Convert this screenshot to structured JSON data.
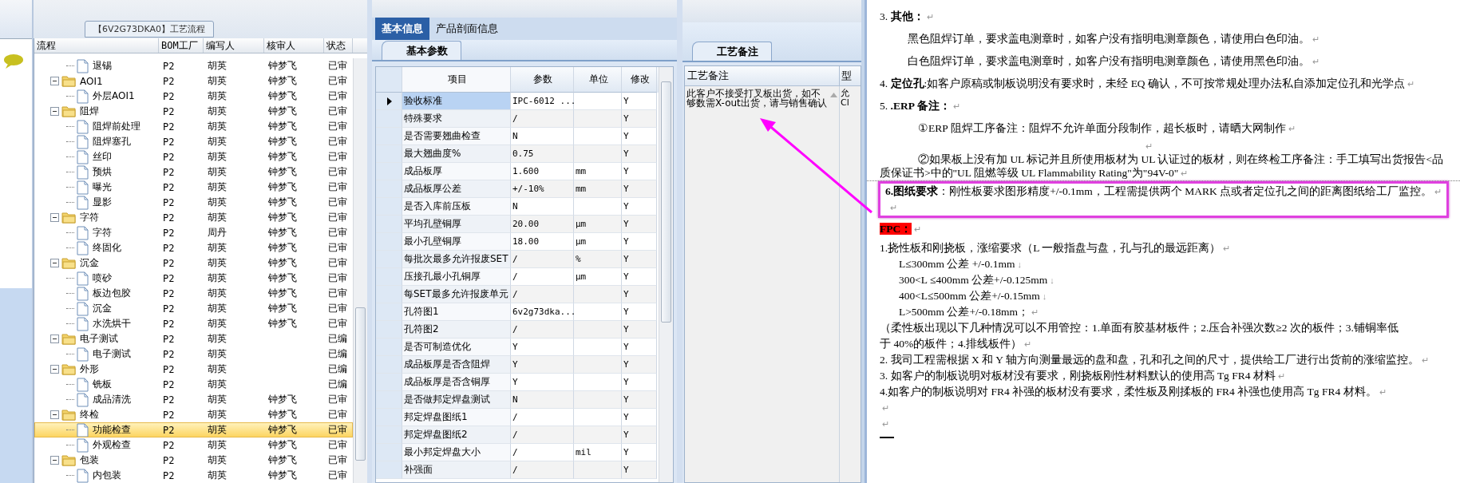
{
  "tree_panel": {
    "title": "【6V2G73DKA0】工艺流程",
    "columns": [
      "流程",
      "BOM工厂",
      "编写人",
      "核审人",
      "状态"
    ],
    "rows": [
      {
        "children": [
          {
            "name": "退锡",
            "bom": "P2",
            "author": "胡英",
            "reviewer": "钟梦飞",
            "status": "已审",
            "selected": false
          }
        ]
      },
      {
        "name": "AOI1",
        "bom": "P2",
        "author": "胡英",
        "reviewer": "钟梦飞",
        "status": "已审",
        "selected": false,
        "expanded": true,
        "children": [
          {
            "name": "外层AOI1",
            "bom": "P2",
            "author": "胡英",
            "reviewer": "钟梦飞",
            "status": "已审",
            "selected": false
          }
        ]
      },
      {
        "name": "阻焊",
        "bom": "P2",
        "author": "胡英",
        "reviewer": "钟梦飞",
        "status": "已审",
        "selected": false,
        "expanded": true,
        "children": [
          {
            "name": "阻焊前处理",
            "bom": "P2",
            "author": "胡英",
            "reviewer": "钟梦飞",
            "status": "已审",
            "selected": false
          },
          {
            "name": "阻焊塞孔",
            "bom": "P2",
            "author": "胡英",
            "reviewer": "钟梦飞",
            "status": "已审",
            "selected": false
          },
          {
            "name": "丝印",
            "bom": "P2",
            "author": "胡英",
            "reviewer": "钟梦飞",
            "status": "已审",
            "selected": false
          },
          {
            "name": "预烘",
            "bom": "P2",
            "author": "胡英",
            "reviewer": "钟梦飞",
            "status": "已审",
            "selected": false
          },
          {
            "name": "曝光",
            "bom": "P2",
            "author": "胡英",
            "reviewer": "钟梦飞",
            "status": "已审",
            "selected": false
          },
          {
            "name": "显影",
            "bom": "P2",
            "author": "胡英",
            "reviewer": "钟梦飞",
            "status": "已审",
            "selected": false
          }
        ]
      },
      {
        "name": "字符",
        "bom": "P2",
        "author": "胡英",
        "reviewer": "钟梦飞",
        "status": "已审",
        "selected": false,
        "expanded": true,
        "children": [
          {
            "name": "字符",
            "bom": "P2",
            "author": "周丹",
            "reviewer": "钟梦飞",
            "status": "已审",
            "selected": false
          },
          {
            "name": "终固化",
            "bom": "P2",
            "author": "胡英",
            "reviewer": "钟梦飞",
            "status": "已审",
            "selected": false
          }
        ]
      },
      {
        "name": "沉金",
        "bom": "P2",
        "author": "胡英",
        "reviewer": "钟梦飞",
        "status": "已审",
        "selected": false,
        "expanded": true,
        "children": [
          {
            "name": "喷砂",
            "bom": "P2",
            "author": "胡英",
            "reviewer": "钟梦飞",
            "status": "已审",
            "selected": false
          },
          {
            "name": "板边包胶",
            "bom": "P2",
            "author": "胡英",
            "reviewer": "钟梦飞",
            "status": "已审",
            "selected": false
          },
          {
            "name": "沉金",
            "bom": "P2",
            "author": "胡英",
            "reviewer": "钟梦飞",
            "status": "已审",
            "selected": false
          },
          {
            "name": "水洗烘干",
            "bom": "P2",
            "author": "胡英",
            "reviewer": "钟梦飞",
            "status": "已审",
            "selected": false
          }
        ]
      },
      {
        "name": "电子测试",
        "bom": "P2",
        "author": "胡英",
        "status": "已编",
        "selected": false,
        "expanded": true,
        "children": [
          {
            "name": "电子测试",
            "bom": "P2",
            "author": "胡英",
            "status": "已编",
            "selected": false
          }
        ]
      },
      {
        "name": "外形",
        "bom": "P2",
        "author": "胡英",
        "status": "已编",
        "selected": false,
        "expanded": true,
        "children": [
          {
            "name": "铣板",
            "bom": "P2",
            "author": "胡英",
            "status": "已编",
            "selected": false
          },
          {
            "name": "成品清洗",
            "bom": "P2",
            "author": "胡英",
            "reviewer": "钟梦飞",
            "status": "已审",
            "selected": false
          }
        ]
      },
      {
        "name": "终检",
        "bom": "P2",
        "author": "胡英",
        "reviewer": "钟梦飞",
        "status": "已审",
        "selected": false,
        "expanded": true,
        "children": [
          {
            "name": "功能检查",
            "bom": "P2",
            "author": "胡英",
            "reviewer": "钟梦飞",
            "status": "已审",
            "selected": true
          },
          {
            "name": "外观检查",
            "bom": "P2",
            "author": "胡英",
            "reviewer": "钟梦飞",
            "status": "已审",
            "selected": false
          }
        ]
      },
      {
        "name": "包装",
        "bom": "P2",
        "author": "胡英",
        "reviewer": "钟梦飞",
        "status": "已审",
        "selected": false,
        "expanded": true,
        "children": [
          {
            "name": "内包装",
            "bom": "P2",
            "author": "胡英",
            "reviewer": "钟梦飞",
            "status": "已审",
            "selected": false
          }
        ]
      }
    ]
  },
  "info_panel": {
    "tabs": [
      {
        "label": "基本信息",
        "selected": true
      },
      {
        "label": "产品剖面信息",
        "selected": false
      }
    ],
    "subtab": "基本参数",
    "columns": [
      "项目",
      "参数",
      "单位",
      "修改"
    ],
    "rows": [
      {
        "item": "验收标准",
        "value": "IPC-6012 ...",
        "modified": "Y",
        "selected": true
      },
      {
        "item": "特殊要求",
        "value": "/",
        "modified": "Y",
        "selected": false
      },
      {
        "item": "是否需要翘曲检查",
        "value": "N",
        "modified": "Y",
        "selected": false
      },
      {
        "item": "最大翘曲度%",
        "value": "0.75",
        "modified": "Y",
        "selected": false
      },
      {
        "item": "成品板厚",
        "value": "1.600",
        "unit": "mm",
        "modified": "Y",
        "selected": false
      },
      {
        "item": "成品板厚公差",
        "value": "+/-10%",
        "unit": "mm",
        "modified": "Y",
        "selected": false
      },
      {
        "item": "是否入库前压板",
        "value": "N",
        "modified": "Y",
        "selected": false
      },
      {
        "item": "平均孔壁铜厚",
        "value": "20.00",
        "unit": "μm",
        "modified": "Y",
        "selected": false
      },
      {
        "item": "最小孔壁铜厚",
        "value": "18.00",
        "unit": "μm",
        "modified": "Y",
        "selected": false
      },
      {
        "item": "每批次最多允许报废SET",
        "value": "/",
        "unit": "%",
        "modified": "Y",
        "selected": false
      },
      {
        "item": "压接孔最小孔铜厚",
        "value": "/",
        "unit": "μm",
        "modified": "Y",
        "selected": false
      },
      {
        "item": "每SET最多允许报废单元",
        "value": "/",
        "modified": "Y",
        "selected": false
      },
      {
        "item": "孔符图1",
        "value": "6v2g73dka...",
        "modified": "Y",
        "selected": false
      },
      {
        "item": "孔符图2",
        "value": "/",
        "modified": "Y",
        "selected": false
      },
      {
        "item": "是否可制造优化",
        "value": "Y",
        "modified": "Y",
        "selected": false
      },
      {
        "item": "成品板厚是否含阻焊",
        "value": "Y",
        "modified": "Y",
        "selected": false
      },
      {
        "item": "成品板厚是否含铜厚",
        "value": "Y",
        "modified": "Y",
        "selected": false
      },
      {
        "item": "是否做邦定焊盘测试",
        "value": "N",
        "modified": "Y",
        "selected": false
      },
      {
        "item": "邦定焊盘图纸1",
        "value": "/",
        "modified": "Y",
        "selected": false
      },
      {
        "item": "邦定焊盘图纸2",
        "value": "/",
        "modified": "Y",
        "selected": false
      },
      {
        "item": "最小邦定焊盘大小",
        "value": "/",
        "unit": "mil",
        "modified": "Y",
        "selected": false
      },
      {
        "item": "补强面",
        "value": "/",
        "modified": "Y",
        "selected": false
      }
    ]
  },
  "remarks_panel": {
    "tab": "工艺备注",
    "columns": [
      "工艺备注",
      "型"
    ],
    "remark": "此客户不接受打叉板出货，如不够数需X-out出货，请与销售确认",
    "column_2_lines": [
      "允",
      "Cl"
    ]
  },
  "document": {
    "upper_lines": [
      {
        "kind": "plain",
        "text": "3.  **其他：**",
        "mark": "↵"
      },
      {
        "kind": "indented",
        "text": "黑色阻焊订单，要求盖电测章时，如客户没有指明电测章颜色，请使用白色印油。",
        "mark": "↵"
      },
      {
        "kind": "indented",
        "text": "白色阻焊订单，要求盖电测章时，如客户没有指明电测章颜色，请使用黑色印油。",
        "mark": "↵"
      },
      {
        "kind": "plain",
        "text": "4.  **定位孔**:如客户原稿或制板说明没有要求时，未经 EQ 确认，不可按常规处理办法私自添加定位孔和光学点",
        "mark": "↵"
      },
      {
        "kind": "plain",
        "text": "5. **.ERP 备注：**",
        "mark": "↵"
      },
      {
        "kind": "sub",
        "text": "①ERP 阻焊工序备注：阻焊不允许单面分段制作，超长板时，请晒大网制作",
        "mark": "↵"
      },
      {
        "kind": "blank",
        "mark": "↵"
      },
      {
        "kind": "sub_first",
        "text": "②如果板上没有加 UL 标记并且所使用板材为 UL 认证过的板材，则在终检工序备注：手工填写出货报告<品"
      },
      {
        "kind": "sub_cont",
        "text": "质保证书>中的\"UL 阻燃等级 UL Flammability Rating\"为\"94V-0\"",
        "mark": "↵"
      }
    ],
    "callout": {
      "lines": [
        {
          "kind": "plain",
          "text": "**6.图纸要求**：刚性板要求图形精度+/-0.1mm，工程需提供两个 MARK 点或者定位孔之间的距离图纸给工厂监控。",
          "mark": "↵"
        },
        {
          "kind": "blank",
          "mark": "↵"
        }
      ]
    },
    "lower_lines": [
      {
        "kind": "highlight",
        "text": "FPC：",
        "mark": "↵"
      },
      {
        "kind": "tight",
        "text": "1.挠性板和刚挠板，涨缩要求（L 一般指盘与盘，孔与孔的最远距离）",
        "mark": "↵"
      },
      {
        "kind": "tight_indented",
        "text": "L≤300mm 公差 +/-0.1mm",
        "mark": "↓"
      },
      {
        "kind": "tight_indented",
        "text": "300<L ≤400mm 公差+/-0.125mm",
        "mark": "↓"
      },
      {
        "kind": "tight_indented",
        "text": "400<L≤500mm 公差+/-0.15mm",
        "mark": "↓"
      },
      {
        "kind": "tight_indented",
        "text": "L>500mm 公差+/-0.18mm；",
        "mark": "↵"
      },
      {
        "kind": "tight",
        "text": "（柔性板出现以下几种情况可以不用管控：1.单面有胶基材板件；2.压合补强次数≥2 次的板件；3.铺铜率低"
      },
      {
        "kind": "tight",
        "text": "于 40%的板件；4.排线板件）",
        "mark": "↵"
      },
      {
        "kind": "tight",
        "text": "2.    我司工程需根据 X 和 Y 轴方向测量最远的盘和盘，孔和孔之间的尺寸，提供给工厂进行出货前的涨缩监控。",
        "mark": "↵"
      },
      {
        "kind": "tight",
        "text": "3.  如客户的制板说明对板材没有要求，刚挠板刚性材料默认的使用高 Tg FR4 材料",
        "mark": "↵"
      },
      {
        "kind": "tight",
        "text": " 4.如客户的制板说明对 FR4 补强的板材没有要求，柔性板及刚揉板的 FR4 补强也使用高 Tg FR4 材料。",
        "mark": "↵"
      },
      {
        "kind": "tight_blank",
        "mark": "↵"
      },
      {
        "kind": "tight_blank",
        "mark": "↵"
      }
    ]
  }
}
